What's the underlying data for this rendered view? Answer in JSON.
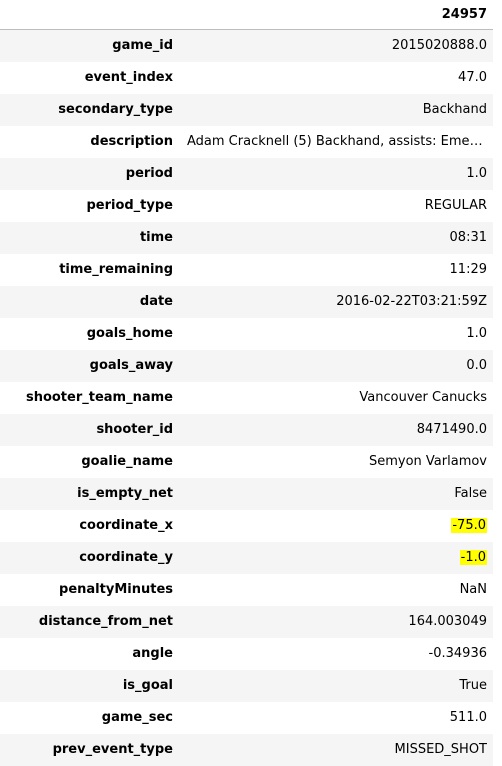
{
  "table": {
    "column_header": "24957",
    "rows": [
      {
        "key": "game_id",
        "value": "2015020888.0",
        "highlight": false
      },
      {
        "key": "event_index",
        "value": "47.0",
        "highlight": false
      },
      {
        "key": "secondary_type",
        "value": "Backhand",
        "highlight": false
      },
      {
        "key": "description",
        "value": "Adam Cracknell (5) Backhand, assists: Emerson ...",
        "highlight": false
      },
      {
        "key": "period",
        "value": "1.0",
        "highlight": false
      },
      {
        "key": "period_type",
        "value": "REGULAR",
        "highlight": false
      },
      {
        "key": "time",
        "value": "08:31",
        "highlight": false
      },
      {
        "key": "time_remaining",
        "value": "11:29",
        "highlight": false
      },
      {
        "key": "date",
        "value": "2016-02-22T03:21:59Z",
        "highlight": false
      },
      {
        "key": "goals_home",
        "value": "1.0",
        "highlight": false
      },
      {
        "key": "goals_away",
        "value": "0.0",
        "highlight": false
      },
      {
        "key": "shooter_team_name",
        "value": "Vancouver Canucks",
        "highlight": false
      },
      {
        "key": "shooter_id",
        "value": "8471490.0",
        "highlight": false
      },
      {
        "key": "goalie_name",
        "value": "Semyon Varlamov",
        "highlight": false
      },
      {
        "key": "is_empty_net",
        "value": "False",
        "highlight": false
      },
      {
        "key": "coordinate_x",
        "value": "-75.0",
        "highlight": true
      },
      {
        "key": "coordinate_y",
        "value": "-1.0",
        "highlight": true
      },
      {
        "key": "penaltyMinutes",
        "value": "NaN",
        "highlight": false
      },
      {
        "key": "distance_from_net",
        "value": "164.003049",
        "highlight": false
      },
      {
        "key": "angle",
        "value": "-0.34936",
        "highlight": false
      },
      {
        "key": "is_goal",
        "value": "True",
        "highlight": false
      },
      {
        "key": "game_sec",
        "value": "511.0",
        "highlight": false
      },
      {
        "key": "prev_event_type",
        "value": "MISSED_SHOT",
        "highlight": false
      }
    ]
  },
  "colors": {
    "highlight": "#ffff00",
    "stripe": "#f5f5f5",
    "border": "#bdbdbd"
  }
}
